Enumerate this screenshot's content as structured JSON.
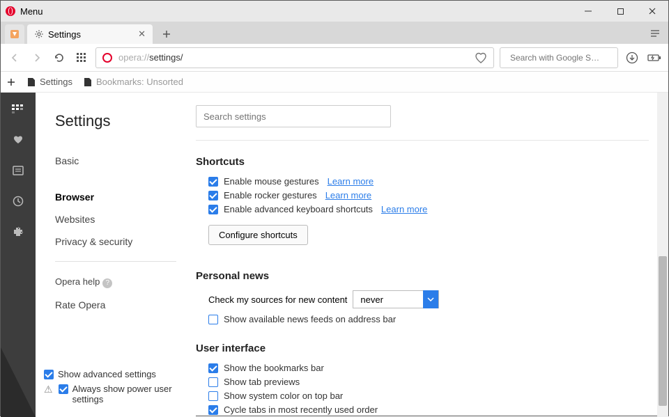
{
  "titlebar": {
    "menu": "Menu"
  },
  "tabs": {
    "active_label": "Settings"
  },
  "address": {
    "prefix": "opera://",
    "path": "settings/",
    "search_placeholder": "Search with Google S…"
  },
  "bookmarks_bar": {
    "item1": "Settings",
    "item2": "Bookmarks: Unsorted"
  },
  "settings": {
    "title": "Settings",
    "nav": {
      "basic": "Basic",
      "browser": "Browser",
      "websites": "Websites",
      "privacy": "Privacy & security",
      "help": "Opera help",
      "rate": "Rate Opera"
    },
    "bottom": {
      "show_adv": "Show advanced settings",
      "power_user": "Always show power user settings"
    },
    "search_placeholder": "Search settings",
    "sections": {
      "shortcuts": {
        "title": "Shortcuts",
        "mouse": "Enable mouse gestures",
        "rocker": "Enable rocker gestures",
        "keyboard": "Enable advanced keyboard shortcuts",
        "learn": "Learn more",
        "configure": "Configure shortcuts"
      },
      "news": {
        "title": "Personal news",
        "check_label": "Check my sources for new content",
        "check_value": "never",
        "feeds": "Show available news feeds on address bar"
      },
      "ui": {
        "title": "User interface",
        "bookmarks": "Show the bookmarks bar",
        "previews": "Show tab previews",
        "syscolor": "Show system color on top bar",
        "cycle": "Cycle tabs in most recently used order"
      }
    }
  }
}
